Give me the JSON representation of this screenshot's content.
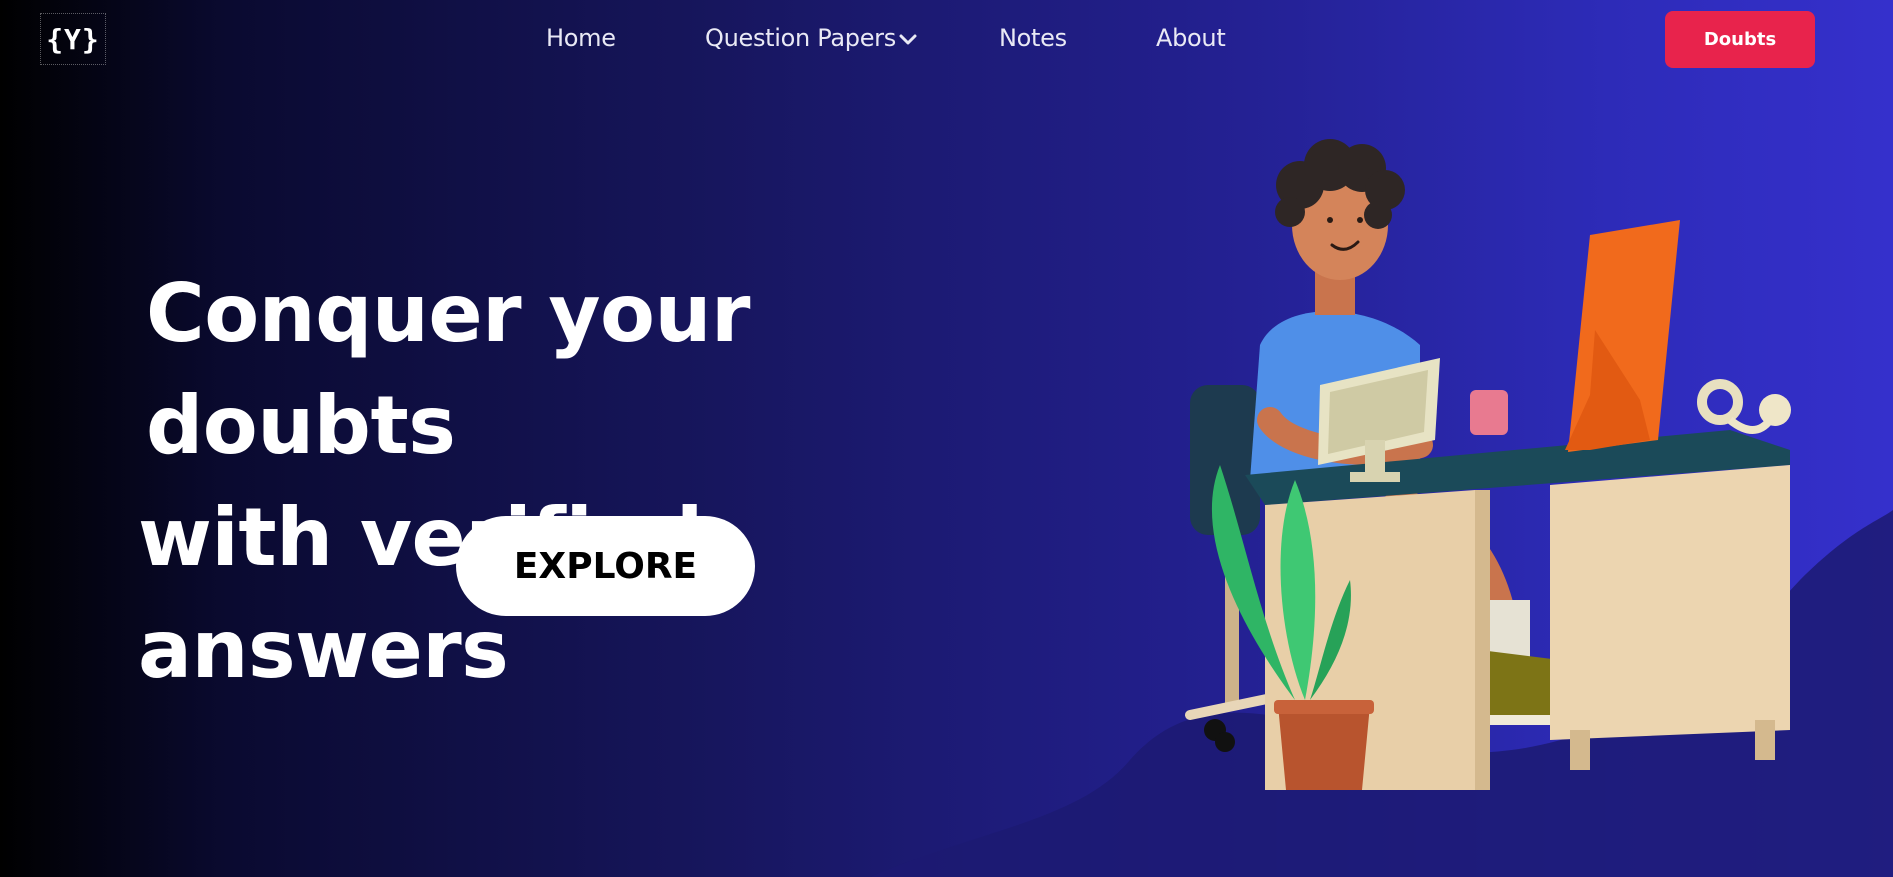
{
  "brand": {
    "logo_text": "{Y}"
  },
  "nav": {
    "items": [
      {
        "label": "Home"
      },
      {
        "label": "Question Papers",
        "icon": "chevron-down-icon"
      },
      {
        "label": "Notes"
      },
      {
        "label": "About"
      }
    ],
    "cta_label": "Doubts"
  },
  "hero": {
    "headline_line1": "Conquer your doubts",
    "headline_line2": "with verified answers",
    "cta_label": "EXPLORE",
    "illustration": "person-at-desk-illustration"
  },
  "colors": {
    "accent": "#e8234c",
    "background_start": "#000000",
    "background_end": "#3530cc",
    "text": "#ffffff"
  }
}
